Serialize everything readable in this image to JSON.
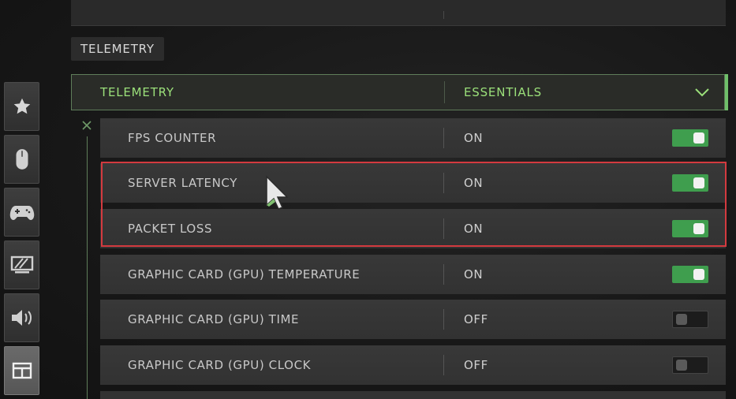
{
  "section": {
    "tag": "TELEMETRY"
  },
  "header": {
    "label": "TELEMETRY",
    "value": "ESSENTIALS",
    "expand_icon": "chevron-down-icon"
  },
  "sidebar": {
    "items": [
      {
        "icon": "star-icon",
        "active": false
      },
      {
        "icon": "mouse-icon",
        "active": false
      },
      {
        "icon": "gamepad-icon",
        "active": false
      },
      {
        "icon": "display-icon",
        "active": false
      },
      {
        "icon": "speaker-icon",
        "active": false
      },
      {
        "icon": "interface-icon",
        "active": true
      }
    ]
  },
  "options": [
    {
      "label": "FPS COUNTER",
      "value": "ON",
      "on": true
    },
    {
      "label": "SERVER LATENCY",
      "value": "ON",
      "on": true
    },
    {
      "label": "PACKET LOSS",
      "value": "ON",
      "on": true
    },
    {
      "label": "GRAPHIC CARD (GPU) TEMPERATURE",
      "value": "ON",
      "on": true
    },
    {
      "label": "GRAPHIC CARD (GPU) TIME",
      "value": "OFF",
      "on": false
    },
    {
      "label": "GRAPHIC CARD (GPU) CLOCK",
      "value": "OFF",
      "on": false
    }
  ],
  "colors": {
    "accent_green": "#9be07a",
    "toggle_on": "#3f9e4e",
    "highlight_red": "#d33a3f"
  }
}
